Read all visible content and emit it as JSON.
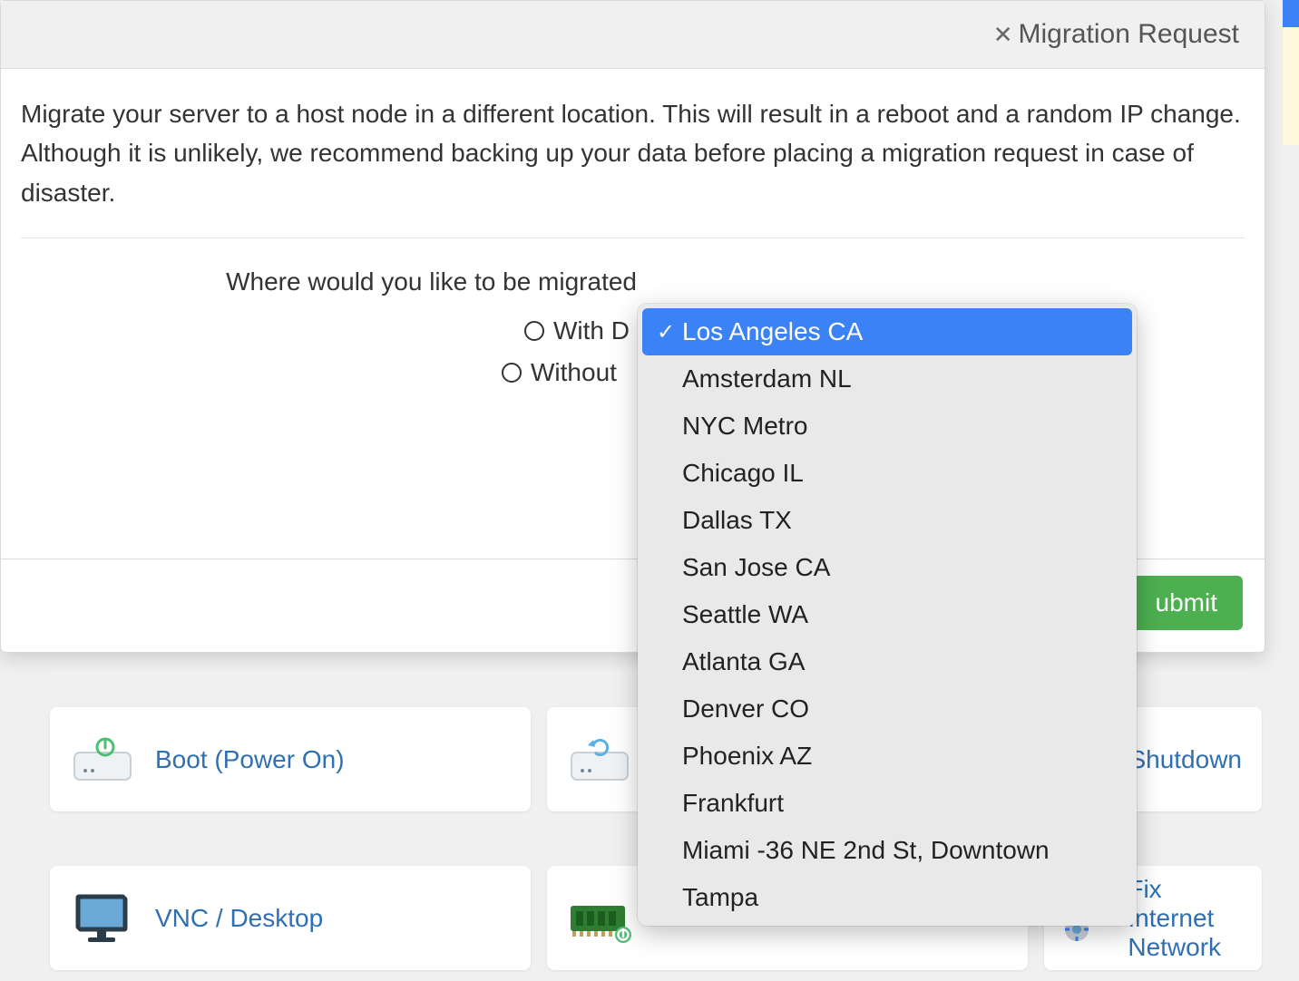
{
  "modal": {
    "title": "Migration Request",
    "description": "Migrate your server to a host node in a different location. This will result in a reboot and a random IP change. Although it is unlikely, we recommend backing up your data before placing a migration request in case of disaster.",
    "location_label": "Where would you like to be migrated",
    "radio1": "With D",
    "radio2": "Without",
    "submit": "ubmit"
  },
  "dropdown": {
    "items": [
      "Los Angeles CA",
      "Amsterdam NL",
      "NYC Metro",
      "Chicago IL",
      "Dallas TX",
      "San Jose CA",
      "Seattle WA",
      "Atlanta GA",
      "Denver CO",
      "Phoenix AZ",
      "Frankfurt",
      "Miami -36 NE 2nd St, Downtown",
      "Tampa"
    ],
    "selected_index": 0
  },
  "cards": {
    "boot": "Boot (Power On)",
    "shutdown": "Shutdown",
    "vnc": "VNC / Desktop",
    "fix_internet": "Fix Internet",
    "network": "Network"
  }
}
